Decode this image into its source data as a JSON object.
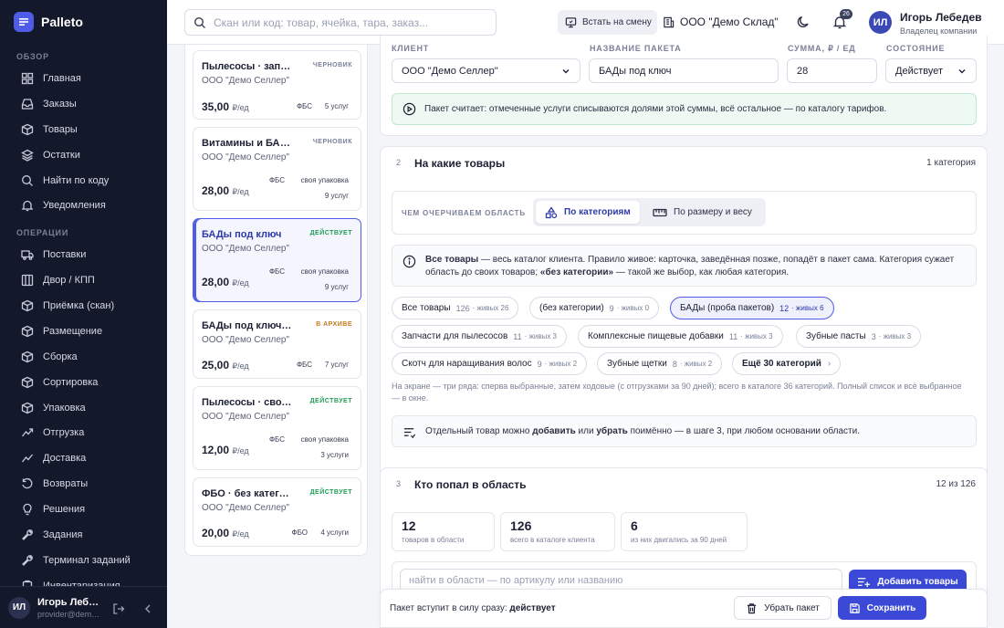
{
  "app": {
    "name": "Palleto"
  },
  "sidebar": {
    "section_overview": "ОБЗОР",
    "section_ops": "ОПЕРАЦИИ",
    "overview_items": [
      {
        "label": "Главная",
        "icon": "grid-icon"
      },
      {
        "label": "Заказы",
        "icon": "inbox-icon"
      },
      {
        "label": "Товары",
        "icon": "box-icon"
      },
      {
        "label": "Остатки",
        "icon": "layers-icon"
      },
      {
        "label": "Найти по коду",
        "icon": "search-icon"
      },
      {
        "label": "Уведомления",
        "icon": "bell-icon"
      }
    ],
    "ops_items": [
      {
        "label": "Поставки",
        "icon": "truck-icon"
      },
      {
        "label": "Двор / КПП",
        "icon": "gate-icon"
      },
      {
        "label": "Приёмка (скан)",
        "icon": "scan-icon"
      },
      {
        "label": "Размещение",
        "icon": "box-icon"
      },
      {
        "label": "Сборка",
        "icon": "box-icon"
      },
      {
        "label": "Сортировка",
        "icon": "filter-icon"
      },
      {
        "label": "Упаковка",
        "icon": "package-icon"
      },
      {
        "label": "Отгрузка",
        "icon": "arrow-out-icon"
      },
      {
        "label": "Доставка",
        "icon": "trend-icon"
      },
      {
        "label": "Возвраты",
        "icon": "return-icon"
      },
      {
        "label": "Решения",
        "icon": "bulb-icon"
      },
      {
        "label": "Задания",
        "icon": "wrench-icon"
      },
      {
        "label": "Терминал заданий",
        "icon": "terminal-icon"
      },
      {
        "label": "Инвентаризация",
        "icon": "clipboard-icon"
      }
    ],
    "user": {
      "initials": "ИЛ",
      "name": "Игорь Лебедев",
      "email": "provider@demo.palleto"
    }
  },
  "topbar": {
    "search_placeholder": "Скан или код: товар, ячейка, тара, заказ...",
    "shift_label": "Встать на смену",
    "org_name": "ООО \"Демо Склад\"",
    "notif_count": "26",
    "user_initials": "ИЛ",
    "user_name": "Игорь Лебедев",
    "user_role": "Владелец компании"
  },
  "packages": [
    {
      "title": "Пылесосы · запчасти",
      "status": "ЧЕРНОВИК",
      "status_color": "#7b8099",
      "client": "ООО \"Демо Селлер\"",
      "price": "35,00",
      "unit": "₽/ед",
      "tags": [
        "ФБС",
        "5 услуг"
      ]
    },
    {
      "title": "Витамины и БАДы",
      "status": "ЧЕРНОВИК",
      "status_color": "#7b8099",
      "client": "ООО \"Демо Селлер\"",
      "price": "28,00",
      "unit": "₽/ед",
      "tags": [
        "ФБС",
        "своя упаковка",
        "9 услуг"
      ]
    },
    {
      "title": "БАДы под ключ",
      "status": "ДЕЙСТВУЕТ",
      "status_color": "#1f9d55",
      "client": "ООО \"Демо Селлер\"",
      "price": "28,00",
      "unit": "₽/ед",
      "tags": [
        "ФБС",
        "своя упаковка",
        "9 услуг"
      ]
    },
    {
      "title": "БАДы под ключ · старый",
      "status": "В АРХИВЕ",
      "status_color": "#c27a18",
      "client": "ООО \"Демо Селлер\"",
      "price": "25,00",
      "unit": "₽/ед",
      "tags": [
        "ФБС",
        "7 услуг"
      ]
    },
    {
      "title": "Пылесосы · своя упаковка",
      "status": "ДЕЙСТВУЕТ",
      "status_color": "#1f9d55",
      "client": "ООО \"Демо Селлер\"",
      "price": "12,00",
      "unit": "₽/ед",
      "tags": [
        "ФБС",
        "своя упаковка",
        "3 услуги"
      ]
    },
    {
      "title": "ФБО · без категорий",
      "status": "ДЕЙСТВУЕТ",
      "status_color": "#1f9d55",
      "client": "ООО \"Демо Селлер\"",
      "price": "20,00",
      "unit": "₽/ед",
      "tags": [
        "ФБО",
        "4 услуги"
      ]
    }
  ],
  "form": {
    "client_label": "КЛИЕНТ",
    "client_value": "ООО \"Демо Селлер\"",
    "name_label": "НАЗВАНИЕ ПАКЕТА",
    "name_value": "БАДы под ключ",
    "sum_label": "СУММА, ₽ / ЕД",
    "sum_value": "28",
    "state_label": "СОСТОЯНИЕ",
    "state_value": "Действует",
    "info": "Пакет считает: отмеченные услуги списываются долями этой суммы, всё остальное — по каталогу тарифов."
  },
  "step2": {
    "num": "2",
    "title": "На какие товары",
    "meta": "1 категория",
    "scope_label": "ЧЕМ ОЧЕРЧИВАЕМ ОБЛАСТЬ",
    "opt_categories": "По категориям",
    "opt_size": "По размеру и весу",
    "info_bold1": "Все товары",
    "info_text1": " — весь каталог клиента. Правило живое: карточка, заведённая позже, попадёт в пакет сама. Категория сужает область до своих товаров; ",
    "info_bold2": "«без категории»",
    "info_text2": " — такой же выбор, как любая категория.",
    "chips": [
      {
        "label": "Все товары",
        "count": "126",
        "live": "· живых 26",
        "on": false
      },
      {
        "label": "(без категории)",
        "count": "9",
        "live": "· живых 0",
        "on": false
      },
      {
        "label": "БАДы (проба пакетов)",
        "count": "12",
        "live": "· живых 6",
        "on": true
      },
      {
        "label": "Запчасти для пылесосов",
        "count": "11",
        "live": "· живых 3",
        "on": false
      },
      {
        "label": "Комплексные пищевые добавки",
        "count": "11",
        "live": "· живых 3",
        "on": false
      },
      {
        "label": "Зубные пасты",
        "count": "3",
        "live": "· живых 3",
        "on": false
      },
      {
        "label": "Скотч для наращивания волос",
        "count": "9",
        "live": "· живых 2",
        "on": false
      },
      {
        "label": "Зубные щетки",
        "count": "8",
        "live": "· живых 2",
        "on": false
      }
    ],
    "more_chip": "Ещё 30 категорий",
    "note": "На экране — три ряда: сперва выбранные, затем ходовые (с отгрузками за 90 дней); всего в каталоге 36 категорий. Полный список и всё выбранное — в окне.",
    "tip_pre": "Отдельный товар можно ",
    "tip_add": "добавить",
    "tip_mid": " или ",
    "tip_remove": "убрать",
    "tip_post": " поимённо — в шаге 3, при любом основании области."
  },
  "step3": {
    "num": "3",
    "title": "Кто попал в область",
    "meta": "12 из 126",
    "stats": [
      {
        "num": "12",
        "sub": "товаров в области"
      },
      {
        "num": "126",
        "sub": "всего в каталоге клиента"
      },
      {
        "num": "6",
        "sub": "из них двигались за 90 дней"
      }
    ],
    "search_placeholder": "найти в области — по артикулу или названию",
    "add_label": "Добавить товары"
  },
  "footer": {
    "text": "Пакет вступит в силу сразу:",
    "state": "действует",
    "remove_label": "Убрать пакет",
    "save_label": "Сохранить"
  },
  "colors": {
    "accent": "#3b49d6",
    "sidebar": "#14182b",
    "active": "#1f9d55",
    "draft": "#7b8099",
    "archive": "#c27a18"
  }
}
